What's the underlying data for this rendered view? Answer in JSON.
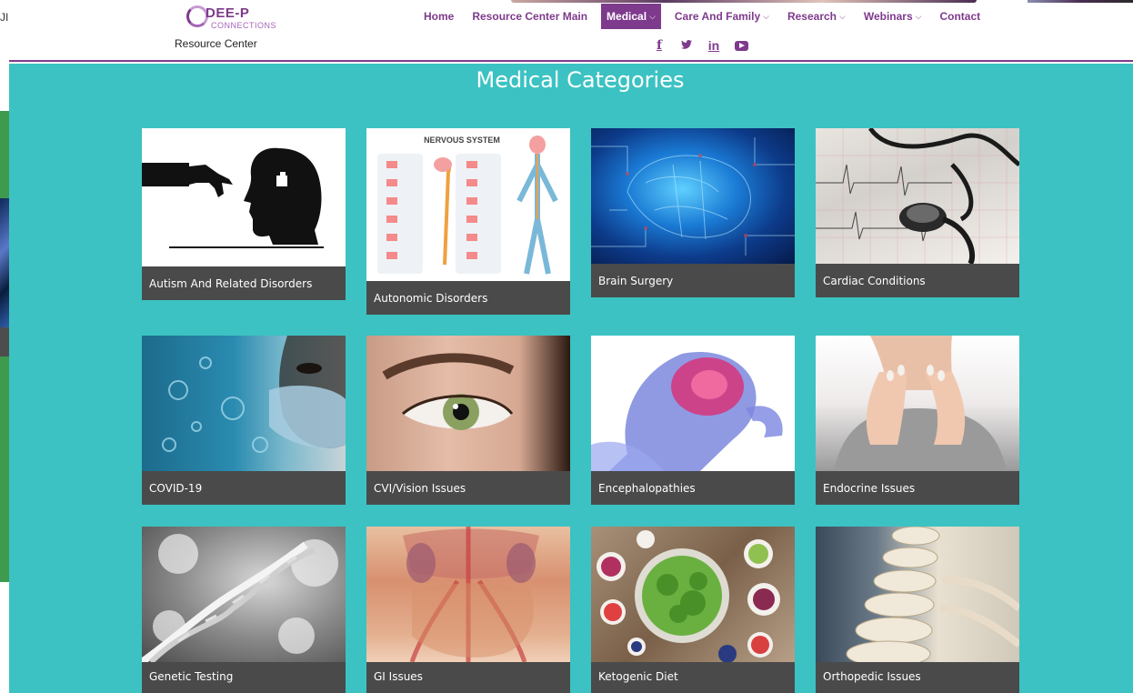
{
  "left_bg": {
    "fragment_text": "JI"
  },
  "header": {
    "logo": {
      "brand": "DEE-P",
      "brand_sub": "CONNECTIONS",
      "subtitle": "Resource Center"
    },
    "nav": [
      {
        "label": "Home",
        "has_dropdown": false,
        "active": false
      },
      {
        "label": "Resource Center Main",
        "has_dropdown": false,
        "active": false
      },
      {
        "label": "Medical",
        "has_dropdown": true,
        "active": true
      },
      {
        "label": "Care And Family",
        "has_dropdown": true,
        "active": false
      },
      {
        "label": "Research",
        "has_dropdown": true,
        "active": false
      },
      {
        "label": "Webinars",
        "has_dropdown": true,
        "active": false
      },
      {
        "label": "Contact",
        "has_dropdown": false,
        "active": false
      }
    ],
    "social": [
      {
        "icon": "facebook-icon",
        "glyph": "f"
      },
      {
        "icon": "twitter-icon",
        "glyph": "🐦"
      },
      {
        "icon": "linkedin-icon",
        "glyph": "in"
      },
      {
        "icon": "youtube-icon",
        "glyph": ""
      }
    ]
  },
  "main": {
    "heading": "Medical Categories",
    "categories": [
      {
        "label": "Autism And Related Disorders"
      },
      {
        "label": "Autonomic Disorders"
      },
      {
        "label": "Brain Surgery"
      },
      {
        "label": "Cardiac Conditions"
      },
      {
        "label": "COVID-19"
      },
      {
        "label": "CVI/Vision Issues"
      },
      {
        "label": "Encephalopathies"
      },
      {
        "label": "Endocrine Issues"
      },
      {
        "label": "Genetic Testing"
      },
      {
        "label": "GI Issues"
      },
      {
        "label": "Ketogenic Diet"
      },
      {
        "label": "Orthopedic Issues"
      }
    ],
    "nervous_system_caption": "NERVOUS SYSTEM"
  },
  "colors": {
    "brand_purple": "#7e3a8c",
    "teal": "#3cc2c2",
    "card_label_bg": "#4a4a4a"
  }
}
